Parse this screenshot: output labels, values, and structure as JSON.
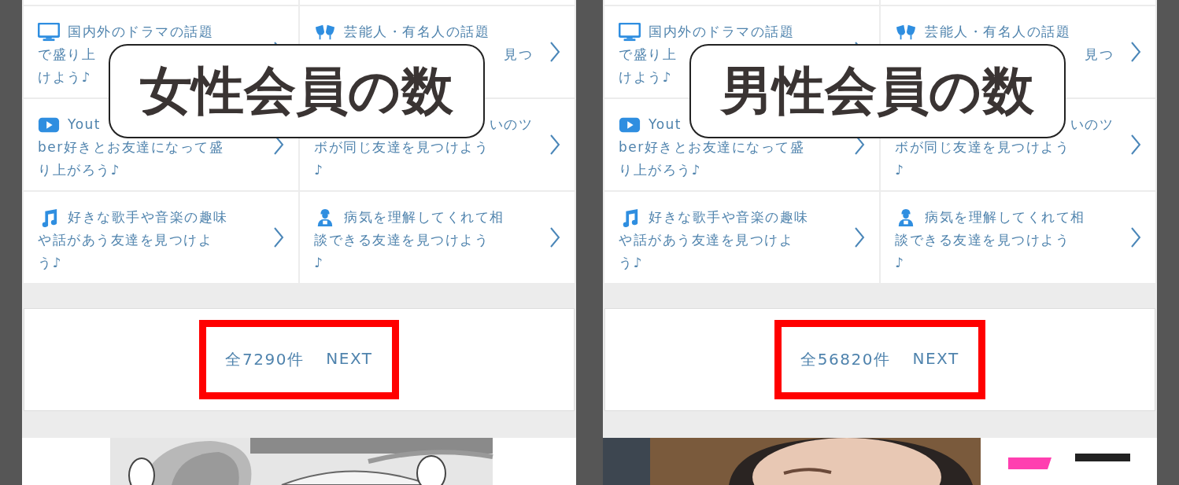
{
  "panels": [
    {
      "heading": "女性会員の数",
      "topics": [
        {
          "kind": "drama",
          "lines": [
            {
              "text": "国内外のドラマの話題"
            },
            {
              "text": "で盛り上"
            },
            {
              "text": "けよう♪"
            }
          ]
        },
        {
          "kind": "celebrity",
          "lines": [
            {
              "text": "芸能人・有名人の話題"
            },
            {
              "text": "見つ",
              "covered_start": true
            }
          ]
        },
        {
          "kind": "youtube",
          "lines": [
            {
              "text": "Yout"
            },
            {
              "text": "ber好きとお友達になって盛"
            },
            {
              "text": "り上がろう♪"
            }
          ]
        },
        {
          "lines": [
            {
              "text": "いのツ",
              "covered_start": true
            },
            {
              "text": "ボが同じ友達を見つけよう"
            },
            {
              "text": "♪"
            }
          ]
        },
        {
          "kind": "music",
          "lines": [
            {
              "text": "好きな歌手や音楽の趣味"
            },
            {
              "text": "や話があう友達を見つけよ"
            },
            {
              "text": "う♪"
            }
          ]
        },
        {
          "kind": "illness",
          "lines": [
            {
              "text": "病気を理解してくれて相"
            },
            {
              "text": "談できる友達を見つけよう"
            },
            {
              "text": "♪"
            }
          ]
        }
      ],
      "pager": {
        "count": "全7290件",
        "next": "NEXT"
      }
    },
    {
      "heading": "男性会員の数",
      "topics": [
        {
          "kind": "drama",
          "lines": [
            {
              "text": "国内外のドラマの話題"
            },
            {
              "text": "で盛り上"
            },
            {
              "text": "けよう♪"
            }
          ]
        },
        {
          "kind": "celebrity",
          "lines": [
            {
              "text": "芸能人・有名人の話題"
            },
            {
              "text": "見つ",
              "covered_start": true
            }
          ]
        },
        {
          "kind": "youtube",
          "lines": [
            {
              "text": "Yout"
            },
            {
              "text": "ber好きとお友達になって盛"
            },
            {
              "text": "り上がろう♪"
            }
          ]
        },
        {
          "lines": [
            {
              "text": "いのツ",
              "covered_start": true
            },
            {
              "text": "ボが同じ友達を見つけよう"
            },
            {
              "text": "♪"
            }
          ]
        },
        {
          "kind": "music",
          "lines": [
            {
              "text": "好きな歌手や音楽の趣味"
            },
            {
              "text": "や話があう友達を見つけよ"
            },
            {
              "text": "う♪"
            }
          ]
        },
        {
          "kind": "illness",
          "lines": [
            {
              "text": "病気を理解してくれて相"
            },
            {
              "text": "談できる友達を見つけよう"
            },
            {
              "text": "♪"
            }
          ]
        }
      ],
      "pager": {
        "count": "全56820件",
        "next": "NEXT"
      }
    }
  ]
}
